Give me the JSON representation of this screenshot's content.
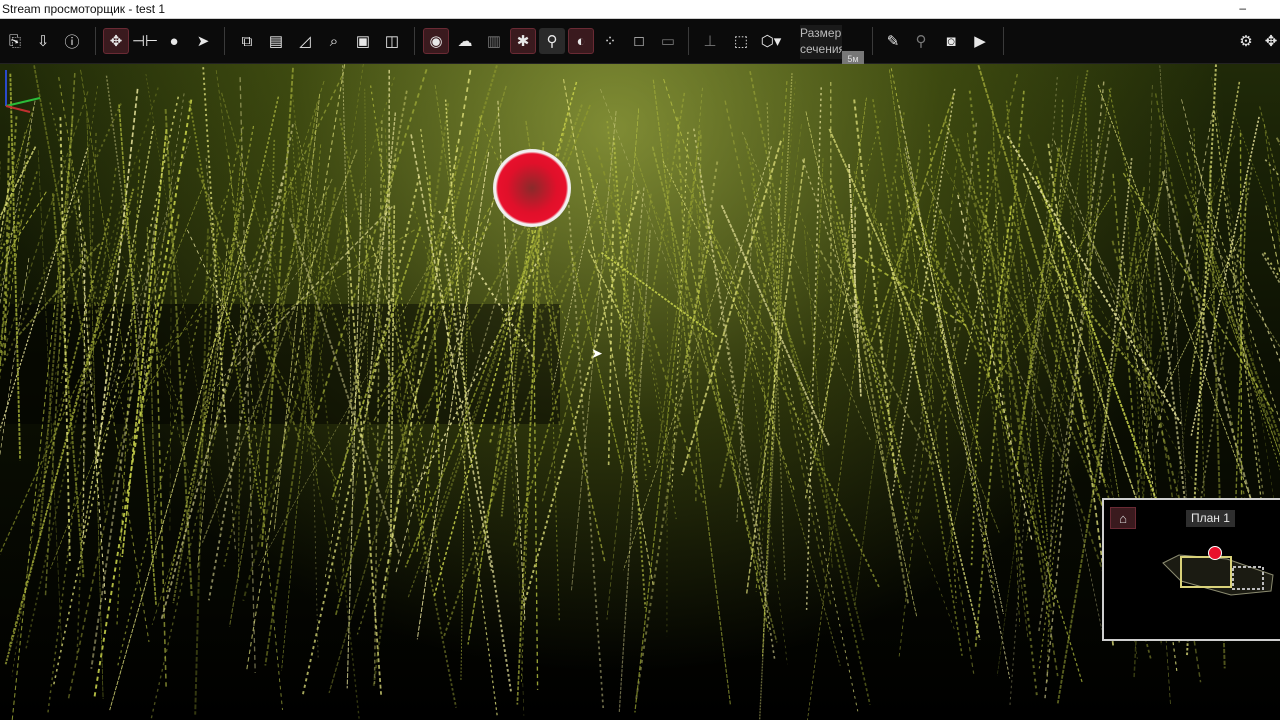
{
  "window": {
    "title": "Stream просмоторщик - test 1",
    "minimize_glyph": "–"
  },
  "toolbar": {
    "icons": [
      "open-icon",
      "export-icon",
      "info-icon",
      "navigate-icon",
      "measure-distance-icon",
      "user-view-icon",
      "fly-icon",
      "copy-view-icon",
      "layers-icon",
      "clip-icon",
      "zoom-fit-icon",
      "image-icon",
      "box-3d-icon",
      "point-mode-icon",
      "cloud-icon",
      "section-icon",
      "ghost-icon",
      "pin-icon",
      "eye-hide-icon",
      "balls-icon",
      "rect-icon",
      "panorama-icon",
      "axis-icon",
      "clip-box-icon",
      "cube-dropdown-icon",
      "ruler-icon",
      "walk-icon",
      "camera-icon",
      "video-icon",
      "settings-icon",
      "overflow-icon"
    ],
    "section_size_label": "Размер сечения",
    "section_size_value": "5м"
  },
  "minimap": {
    "plan_label": "План 1"
  },
  "colors": {
    "accent_red": "#e8102c",
    "cloud_yellow": "#c8d24a",
    "toolbar_bg": "#0b0b0b"
  }
}
